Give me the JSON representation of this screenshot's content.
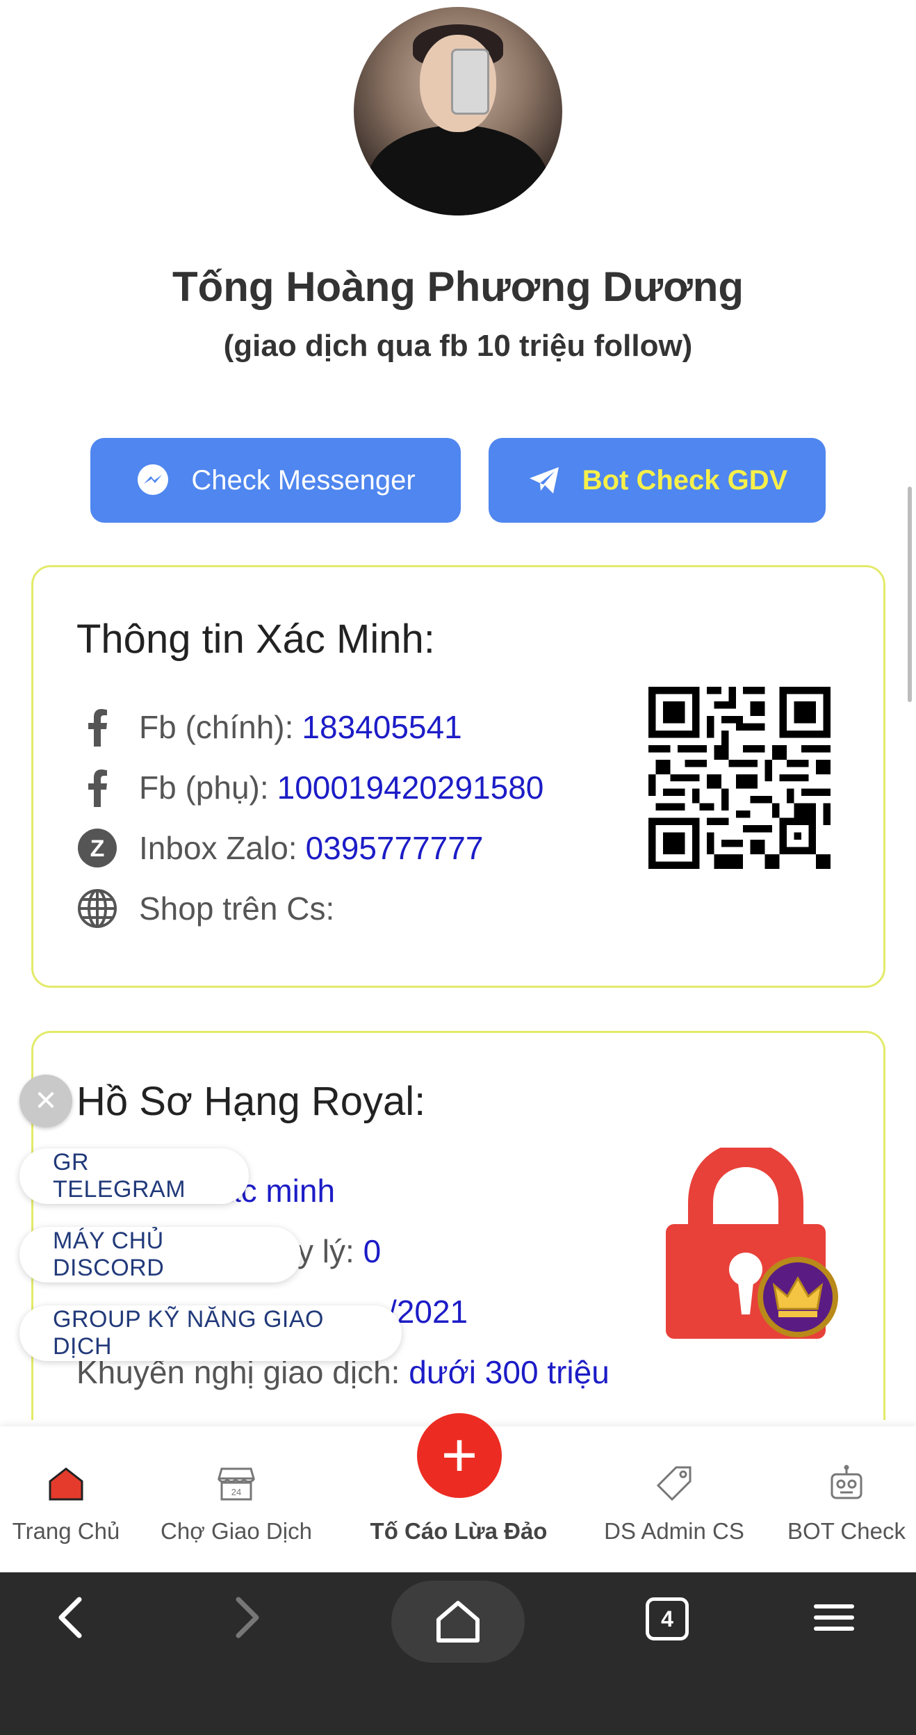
{
  "profile": {
    "name": "Tống Hoàng Phương Dương",
    "subtitle": "(giao dịch qua fb 10 triệu follow)"
  },
  "actions": {
    "messenger_label": "Check Messenger",
    "bot_label": "Bot Check GDV"
  },
  "verification": {
    "title": "Thông tin Xác Minh:",
    "rows": [
      {
        "icon": "facebook-icon",
        "label": "Fb (chính):",
        "value": "183405541"
      },
      {
        "icon": "facebook-icon",
        "label": "Fb (phụ):",
        "value": "100019420291580"
      },
      {
        "icon": "zalo-icon",
        "label": "Inbox Zalo:",
        "value": "0395777777"
      },
      {
        "icon": "globe-icon",
        "label": "Shop trên Cs:",
        "value": ""
      }
    ]
  },
  "royal": {
    "title": "Hồ Sơ Hạng Royal:",
    "rows": [
      {
        "label": "",
        "value": "xác minh"
      },
      {
        "label": "y lý:",
        "value": "0"
      },
      {
        "label": "",
        "value": "/2021"
      },
      {
        "label": "Khuyến nghị giao dịch:",
        "value": "dưới 300 triệu"
      }
    ]
  },
  "floating": {
    "chips": [
      "GR TELEGRAM",
      "MÁY CHỦ DISCORD",
      "GROUP KỸ NĂNG GIAO DỊCH"
    ]
  },
  "bottom_nav": {
    "items": [
      {
        "label": "Trang Chủ",
        "icon": "home-icon"
      },
      {
        "label": "Chợ Giao Dịch",
        "icon": "store-icon"
      },
      {
        "label": "Tố Cáo Lừa Đảo",
        "icon": "plus-icon"
      },
      {
        "label": "DS Admin CS",
        "icon": "tag-icon"
      },
      {
        "label": "BOT Check",
        "icon": "robot-icon"
      }
    ]
  },
  "system_bar": {
    "tab_count": "4"
  },
  "colors": {
    "primary_button": "#4f86ef",
    "bot_text": "#f7f04a",
    "card_border": "#e3ea6a",
    "link_value": "#1c1cc7",
    "report_red": "#ec2c22"
  }
}
